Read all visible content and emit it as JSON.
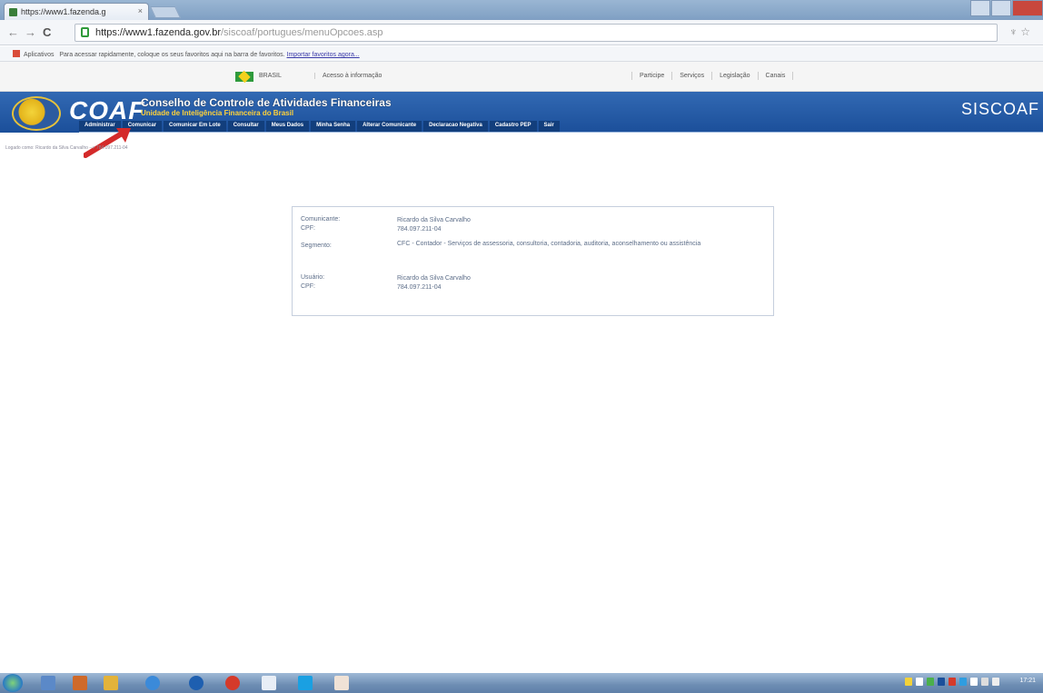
{
  "browser": {
    "tab_title": "https://www1.fazenda.g",
    "tab_close": "×",
    "address_host": "https://www1.fazenda.gov.br",
    "address_path": "/siscoaf/portugues/menuOpcoes.asp",
    "nav_back": "←",
    "nav_forward": "→",
    "nav_reload": "C",
    "toolbar_icons": "♆ ☆"
  },
  "bookmarks": {
    "apps_label": "Aplicativos",
    "hint_text": "Para acessar rapidamente, coloque os seus favoritos aqui na barra de favoritos.",
    "import_link": "Importar favoritos agora..."
  },
  "govbar": {
    "brasil": "BRASIL",
    "acesso": "Acesso à informação",
    "links": [
      "Participe",
      "Serviços",
      "Legislação",
      "Canais"
    ]
  },
  "header": {
    "logo_text": "COAF",
    "title": "Conselho de Controle de Atividades Financeiras",
    "subtitle": "Unidade de Inteligência Financeira do Brasil",
    "app_name": "SISCOAF",
    "menu": [
      "Administrar",
      "Comunicar",
      "Comunicar Em Lote",
      "Consultar",
      "Meus Dados",
      "Minha Senha",
      "Alterar Comunicante",
      "Declaracao Negativa",
      "Cadastro PEP",
      "Sair"
    ]
  },
  "logged_line": "Logado como: Ricardo da Silva Carvalho --> 784.097.211-04",
  "card": {
    "comunicante_label": "Comunicante:",
    "comunicante_value": "Ricardo da Silva Carvalho",
    "cpf1_label": "CPF:",
    "cpf1_value": "784.097.211-04",
    "segmento_label": "Segmento:",
    "segmento_value": "CFC - Contador - Serviços de assessoria, consultoria, contadoria, auditoria, aconselhamento ou assistência",
    "usuario_label": "Usuário:",
    "usuario_value": "Ricardo da Silva Carvalho",
    "cpf2_label": "CPF:",
    "cpf2_value": "784.097.211-04"
  },
  "taskbar": {
    "clock": "17:21"
  },
  "colors": {
    "header_blue": "#1b4f9a",
    "subtitle_yellow": "#ffd23a",
    "arrow_red": "#d42a2a"
  }
}
